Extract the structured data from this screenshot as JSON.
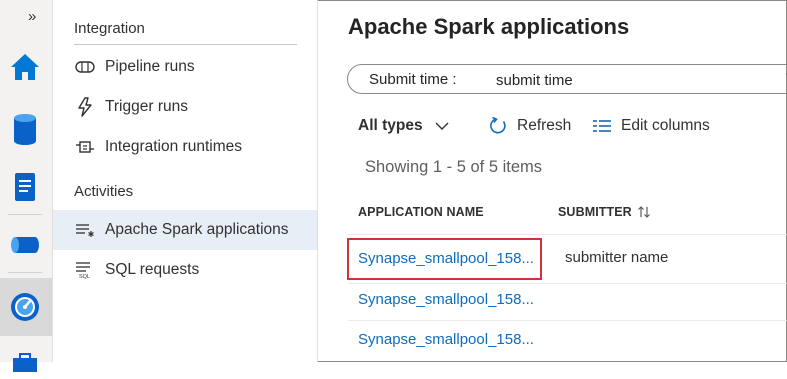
{
  "rail": {
    "collapse_glyph": "»",
    "icons": [
      "home-icon",
      "data-icon",
      "develop-icon",
      "integrate-icon",
      "monitor-icon",
      "manage-icon"
    ]
  },
  "nav": {
    "sections": [
      {
        "label": "Integration"
      },
      {
        "label": "Activities"
      }
    ],
    "items": [
      {
        "label": "Pipeline runs",
        "icon": "pipeline-icon"
      },
      {
        "label": "Trigger runs",
        "icon": "trigger-icon"
      },
      {
        "label": "Integration runtimes",
        "icon": "runtime-icon"
      },
      {
        "label": "Apache Spark applications",
        "icon": "spark-list-icon",
        "selected": true
      },
      {
        "label": "SQL requests",
        "icon": "sql-icon"
      }
    ]
  },
  "main": {
    "title": "Apache Spark applications",
    "filter": {
      "label": "Submit time :",
      "value": "submit time"
    },
    "toolbar": {
      "types_label": "All types",
      "refresh_label": "Refresh",
      "edit_columns_label": "Edit columns"
    },
    "showing": "Showing 1 - 5 of 5 items",
    "table": {
      "columns": [
        "APPLICATION NAME",
        "SUBMITTER"
      ],
      "rows": [
        {
          "name": "Synapse_smallpool_158...",
          "submitter": "submitter name"
        },
        {
          "name": "Synapse_smallpool_158...",
          "submitter": ""
        },
        {
          "name": "Synapse_smallpool_158...",
          "submitter": ""
        }
      ]
    }
  },
  "colors": {
    "accent": "#0f6cbd",
    "highlight_border": "#d13438",
    "selected_bg": "#e8eef6"
  }
}
